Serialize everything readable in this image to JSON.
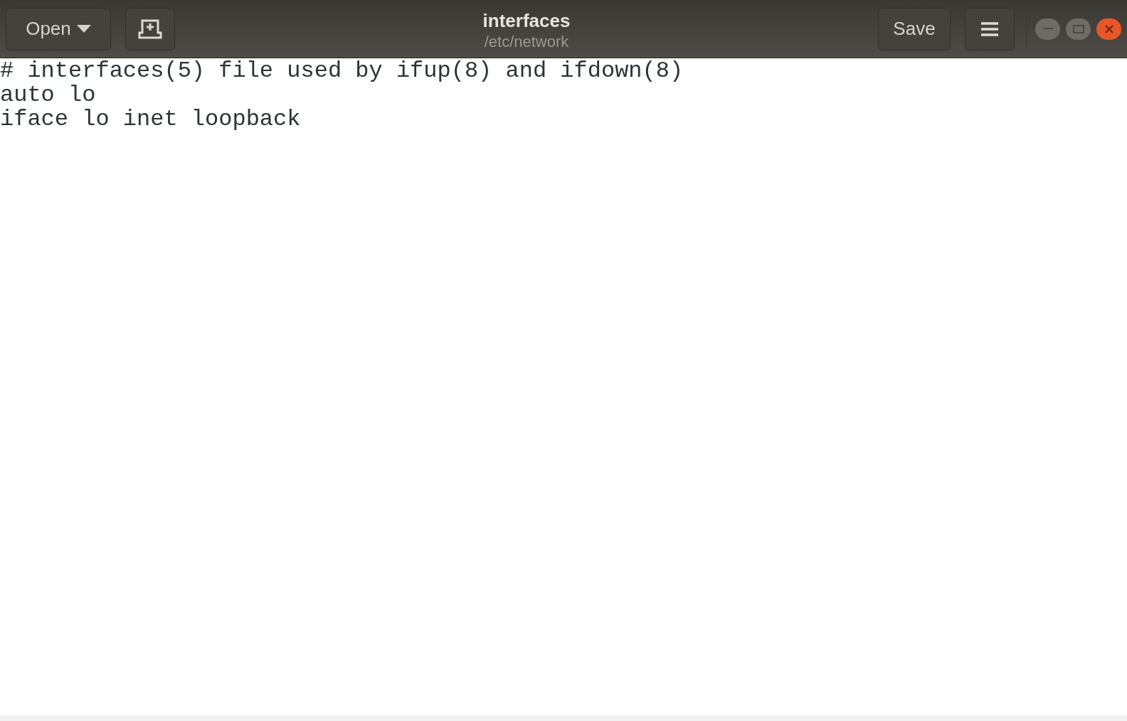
{
  "header_bar": {
    "open_button": {
      "label": "Open"
    },
    "title": "interfaces",
    "subtitle": "/etc/network",
    "save_button": {
      "label": "Save"
    }
  },
  "editor": {
    "lines": [
      "# interfaces(5) file used by ifup(8) and ifdown(8)",
      "auto lo",
      "iface lo inet loopback"
    ]
  }
}
